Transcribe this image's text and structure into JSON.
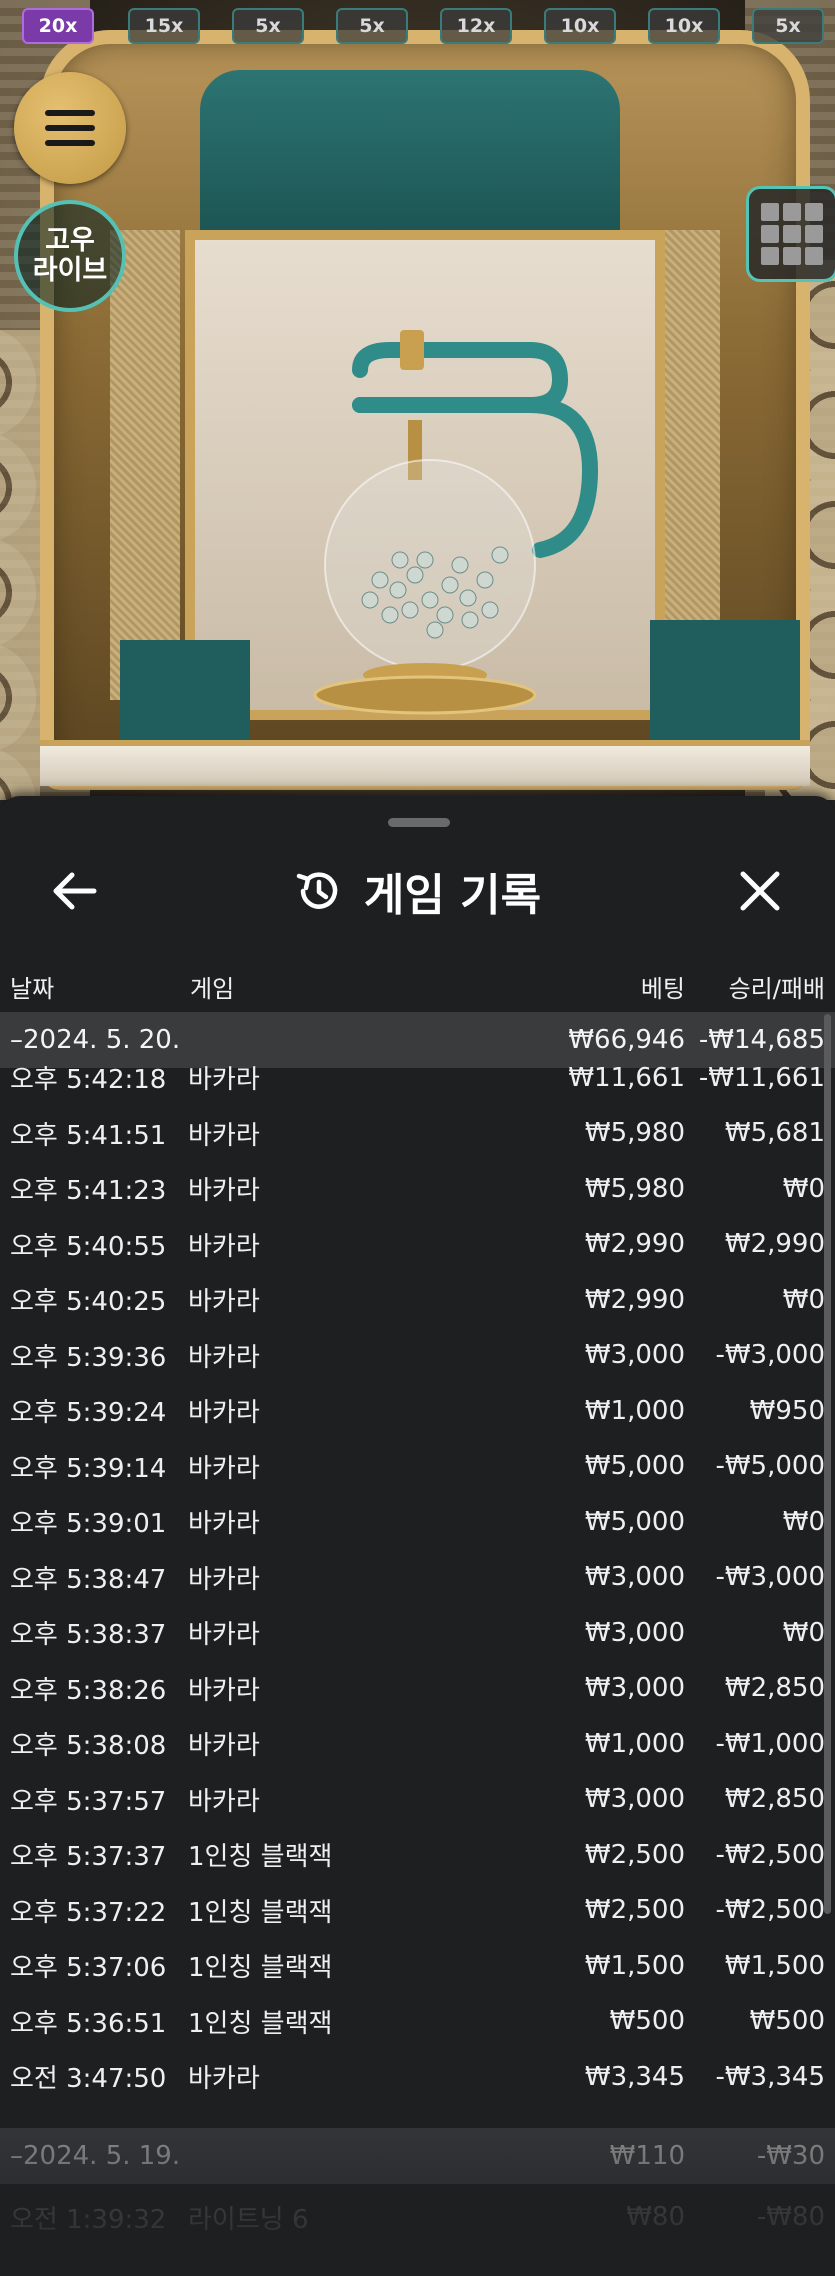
{
  "multipliers": [
    {
      "label": "20x",
      "active": true
    },
    {
      "label": "15x",
      "active": false
    },
    {
      "label": "5x",
      "active": false
    },
    {
      "label": "5x",
      "active": false
    },
    {
      "label": "12x",
      "active": false
    },
    {
      "label": "10x",
      "active": false
    },
    {
      "label": "10x",
      "active": false
    },
    {
      "label": "5x",
      "active": false
    }
  ],
  "logo": {
    "line1": "고우",
    "line2": "라이브"
  },
  "panel": {
    "title": "게임 기록",
    "columns": {
      "date": "날짜",
      "game": "게임",
      "bet": "베팅",
      "result": "승리/패배"
    }
  },
  "day1": {
    "date": "–2024. 5. 20.",
    "bet": "₩66,946",
    "result": "-₩14,685"
  },
  "rows": [
    {
      "time": "오후 5:42:18",
      "game": "바카라",
      "bet": "₩11,661",
      "result": "-₩11,661"
    },
    {
      "time": "오후 5:41:51",
      "game": "바카라",
      "bet": "₩5,980",
      "result": "₩5,681"
    },
    {
      "time": "오후 5:41:23",
      "game": "바카라",
      "bet": "₩5,980",
      "result": "₩0"
    },
    {
      "time": "오후 5:40:55",
      "game": "바카라",
      "bet": "₩2,990",
      "result": "₩2,990"
    },
    {
      "time": "오후 5:40:25",
      "game": "바카라",
      "bet": "₩2,990",
      "result": "₩0"
    },
    {
      "time": "오후 5:39:36",
      "game": "바카라",
      "bet": "₩3,000",
      "result": "-₩3,000"
    },
    {
      "time": "오후 5:39:24",
      "game": "바카라",
      "bet": "₩1,000",
      "result": "₩950"
    },
    {
      "time": "오후 5:39:14",
      "game": "바카라",
      "bet": "₩5,000",
      "result": "-₩5,000"
    },
    {
      "time": "오후 5:39:01",
      "game": "바카라",
      "bet": "₩5,000",
      "result": "₩0"
    },
    {
      "time": "오후 5:38:47",
      "game": "바카라",
      "bet": "₩3,000",
      "result": "-₩3,000"
    },
    {
      "time": "오후 5:38:37",
      "game": "바카라",
      "bet": "₩3,000",
      "result": "₩0"
    },
    {
      "time": "오후 5:38:26",
      "game": "바카라",
      "bet": "₩3,000",
      "result": "₩2,850"
    },
    {
      "time": "오후 5:38:08",
      "game": "바카라",
      "bet": "₩1,000",
      "result": "-₩1,000"
    },
    {
      "time": "오후 5:37:57",
      "game": "바카라",
      "bet": "₩3,000",
      "result": "₩2,850"
    },
    {
      "time": "오후 5:37:37",
      "game": "1인칭 블랙잭",
      "bet": "₩2,500",
      "result": "-₩2,500"
    },
    {
      "time": "오후 5:37:22",
      "game": "1인칭 블랙잭",
      "bet": "₩2,500",
      "result": "-₩2,500"
    },
    {
      "time": "오후 5:37:06",
      "game": "1인칭 블랙잭",
      "bet": "₩1,500",
      "result": "₩1,500"
    },
    {
      "time": "오후 5:36:51",
      "game": "1인칭 블랙잭",
      "bet": "₩500",
      "result": "₩500"
    },
    {
      "time": "오전 3:47:50",
      "game": "바카라",
      "bet": "₩3,345",
      "result": "-₩3,345"
    }
  ],
  "day2": {
    "date": "–2024. 5. 19.",
    "bet": "₩110",
    "result": "-₩30"
  },
  "partial_row": {
    "time": "오전 1:39:32",
    "game": "라이트닝 6",
    "bet": "₩80",
    "result": "-₩80"
  },
  "colors": {
    "panel_bg": "#1e1f21",
    "date_row_bg": "#3a3b3d",
    "accent_teal": "#54c1b4",
    "active_chip": "#7a3aa8"
  }
}
